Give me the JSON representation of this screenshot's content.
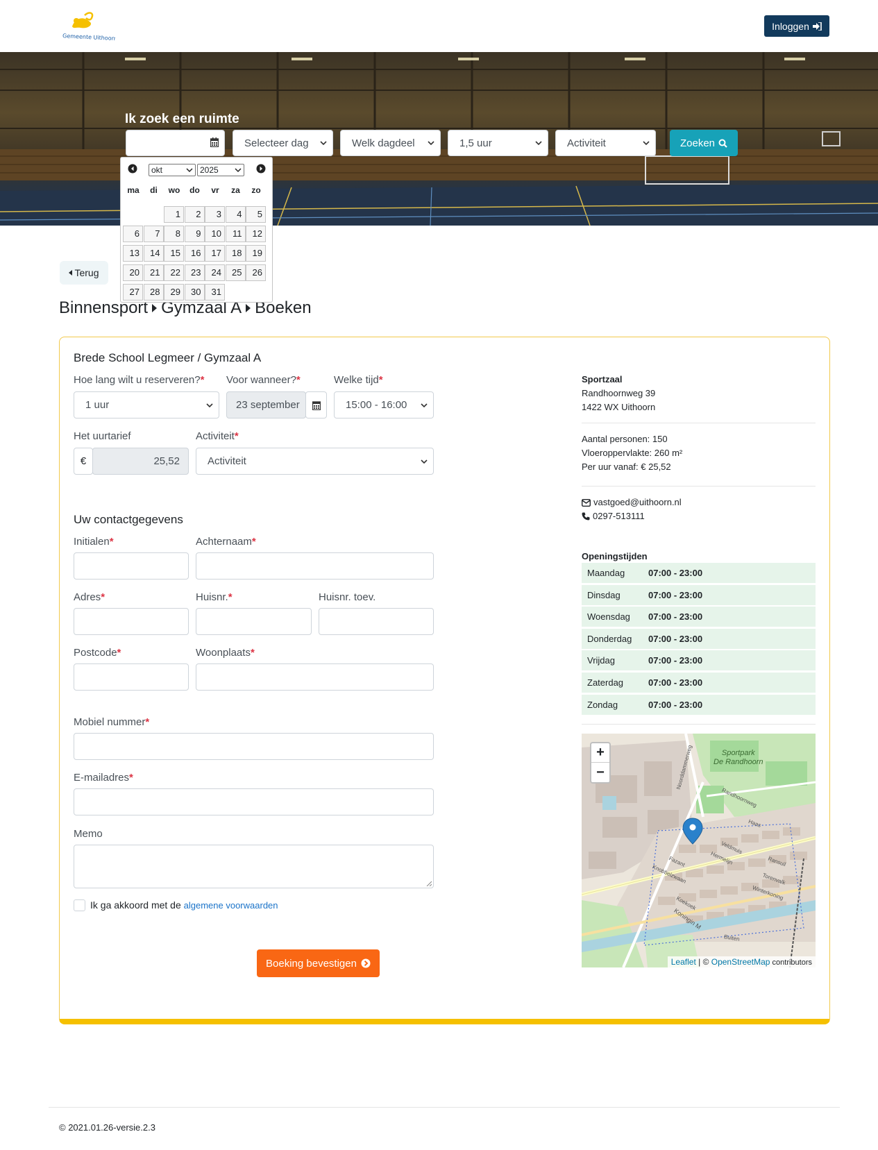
{
  "header": {
    "logo_text": "Gemeente Uithoorn",
    "login_label": "Inloggen"
  },
  "search": {
    "title": "Ik zoek een ruimte",
    "date_value": "",
    "day_select": "Selecteer dag",
    "daypart_select": "Welk dagdeel",
    "duration_select": "1,5 uur",
    "activity_select": "Activiteit",
    "search_label": "Zoeken"
  },
  "datepicker": {
    "month": "okt",
    "year": "2025",
    "weekdays": [
      "ma",
      "di",
      "wo",
      "do",
      "vr",
      "za",
      "zo"
    ],
    "weeks": [
      [
        "",
        "",
        "1",
        "2",
        "3",
        "4",
        "5"
      ],
      [
        "6",
        "7",
        "8",
        "9",
        "10",
        "11",
        "12"
      ],
      [
        "13",
        "14",
        "15",
        "16",
        "17",
        "18",
        "19"
      ],
      [
        "20",
        "21",
        "22",
        "23",
        "24",
        "25",
        "26"
      ],
      [
        "27",
        "28",
        "29",
        "30",
        "31",
        "",
        ""
      ]
    ]
  },
  "nav": {
    "back_label": "Terug",
    "breadcrumb": [
      "Binnensport",
      "Gymzaal A",
      "Boeken"
    ]
  },
  "form": {
    "venue_title": "Brede School Legmeer / Gymzaal A",
    "duration_label": "Hoe lang wilt u reserveren?",
    "duration_value": "1 uur",
    "when_label": "Voor wanneer?",
    "when_value": "23 september",
    "time_label": "Welke tijd",
    "time_value": "15:00 - 16:00",
    "rate_label": "Het uurtarief",
    "currency": "€",
    "rate_value": "25,52",
    "activity_label": "Activiteit",
    "activity_value": "Activiteit",
    "contact_title": "Uw contactgegevens",
    "initials_label": "Initialen",
    "lastname_label": "Achternaam",
    "address_label": "Adres",
    "housenr_label": "Huisnr.",
    "housenr_add_label": "Huisnr. toev.",
    "postcode_label": "Postcode",
    "city_label": "Woonplaats",
    "mobile_label": "Mobiel nummer",
    "email_label": "E-mailadres",
    "memo_label": "Memo",
    "agree_text": "Ik ga akkoord met de",
    "agree_link": "algemene voorwaarden",
    "required_mark": "*",
    "confirm_label": "Boeking bevestigen"
  },
  "info": {
    "name": "Sportzaal",
    "street": "Randhoornweg 39",
    "zip_city": "1422 WX Uithoorn",
    "persons": "Aantal personen: 150",
    "area": "Vloeroppervlakte: 260 m²",
    "price": "Per uur vanaf: € 25,52",
    "email": "vastgoed@uithoorn.nl",
    "phone": "0297-513111",
    "hours_title": "Openingstijden",
    "hours": [
      {
        "day": "Maandag",
        "time": "07:00 - 23:00"
      },
      {
        "day": "Dinsdag",
        "time": "07:00 - 23:00"
      },
      {
        "day": "Woensdag",
        "time": "07:00 - 23:00"
      },
      {
        "day": "Donderdag",
        "time": "07:00 - 23:00"
      },
      {
        "day": "Vrijdag",
        "time": "07:00 - 23:00"
      },
      {
        "day": "Zaterdag",
        "time": "07:00 - 23:00"
      },
      {
        "day": "Zondag",
        "time": "07:00 - 23:00"
      }
    ]
  },
  "map": {
    "zoom_in": "+",
    "zoom_out": "−",
    "park_label_1": "Sportpark",
    "park_label_2": "De Randhoorn",
    "street_labels": [
      "Randhoornweg",
      "Noorddammerweg",
      "Haas",
      "Veldmuis",
      "Hermelijn",
      "Fazant",
      "Knobbelzwaan",
      "Koekoek",
      "Koningin M",
      "Ransuil",
      "Torenvalk",
      "Winterkoning",
      "Buiten"
    ],
    "attribution_leaflet": "Leaflet",
    "attribution_sep": " | © ",
    "attribution_osm": "OpenStreetMap",
    "attribution_tail": " contributors"
  },
  "footer": {
    "copyright": "© 2021.01.26-versie.2.3"
  }
}
